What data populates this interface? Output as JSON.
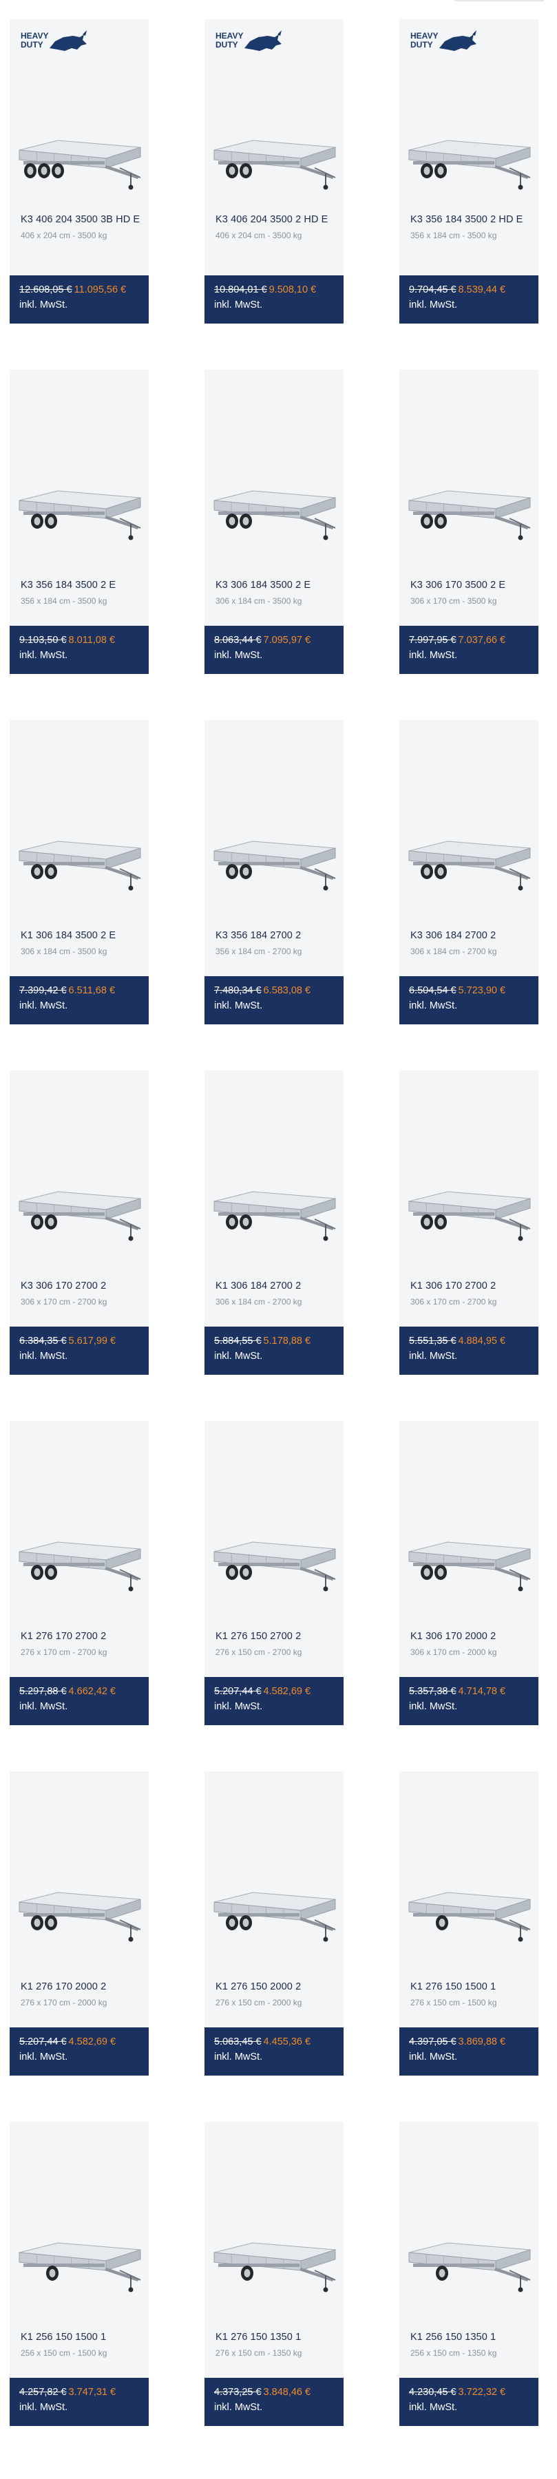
{
  "badge_text_line1": "HEAVY",
  "badge_text_line2": "DUTY",
  "tax_note": "inkl. MwSt.",
  "colors": {
    "card_bg": "#f3f5f7",
    "price_bg": "#1b3260",
    "sale_price": "#f08a28",
    "badge": "#1b3a6b"
  },
  "products": [
    {
      "name": "K3 406 204 3500 3B HD E",
      "spec": "406 x 204 cm - 3500 kg",
      "old_price": "12.608,05 €",
      "price": "11.095,56 €",
      "heavy_duty": true,
      "axles": 3
    },
    {
      "name": "K3 406 204 3500 2 HD E",
      "spec": "406 x 204 cm - 3500 kg",
      "old_price": "10.804,01 €",
      "price": "9.508,10 €",
      "heavy_duty": true,
      "axles": 2
    },
    {
      "name": "K3 356 184 3500 2 HD E",
      "spec": "356 x 184 cm - 3500 kg",
      "old_price": "9.704,45 €",
      "price": "8.539,44 €",
      "heavy_duty": true,
      "axles": 2
    },
    {
      "name": "K3 356 184 3500 2 E",
      "spec": "356 x 184 cm - 3500 kg",
      "old_price": "9.103,50 €",
      "price": "8.011,08 €",
      "heavy_duty": false,
      "axles": 2
    },
    {
      "name": "K3 306 184 3500 2 E",
      "spec": "306 x 184 cm - 3500 kg",
      "old_price": "8.063,44 €",
      "price": "7.095,97 €",
      "heavy_duty": false,
      "axles": 2
    },
    {
      "name": "K3 306 170 3500 2 E",
      "spec": "306 x 170 cm - 3500 kg",
      "old_price": "7.997,95 €",
      "price": "7.037,66 €",
      "heavy_duty": false,
      "axles": 2
    },
    {
      "name": "K1 306 184 3500 2 E",
      "spec": "306 x 184 cm - 3500 kg",
      "old_price": "7.399,42 €",
      "price": "6.511,68 €",
      "heavy_duty": false,
      "axles": 2
    },
    {
      "name": "K3 356 184 2700 2",
      "spec": "356 x 184 cm - 2700 kg",
      "old_price": "7.480,34 €",
      "price": "6.583,08 €",
      "heavy_duty": false,
      "axles": 2
    },
    {
      "name": "K3 306 184 2700 2",
      "spec": "306 x 184 cm - 2700 kg",
      "old_price": "6.504,54 €",
      "price": "5.723,90 €",
      "heavy_duty": false,
      "axles": 2
    },
    {
      "name": "K3 306 170 2700 2",
      "spec": "306 x 170 cm - 2700 kg",
      "old_price": "6.384,35 €",
      "price": "5.617,99 €",
      "heavy_duty": false,
      "axles": 2
    },
    {
      "name": "K1 306 184 2700 2",
      "spec": "306 x 184 cm - 2700 kg",
      "old_price": "5.884,55 €",
      "price": "5.178,88 €",
      "heavy_duty": false,
      "axles": 2
    },
    {
      "name": "K1 306 170 2700 2",
      "spec": "306 x 170 cm - 2700 kg",
      "old_price": "5.551,35 €",
      "price": "4.884,95 €",
      "heavy_duty": false,
      "axles": 2
    },
    {
      "name": "K1 276 170 2700 2",
      "spec": "276 x 170 cm - 2700 kg",
      "old_price": "5.297,88 €",
      "price": "4.662,42 €",
      "heavy_duty": false,
      "axles": 2
    },
    {
      "name": "K1 276 150 2700 2",
      "spec": "276 x 150 cm - 2700 kg",
      "old_price": "5.207,44 €",
      "price": "4.582,69 €",
      "heavy_duty": false,
      "axles": 2
    },
    {
      "name": "K1 306 170 2000 2",
      "spec": "306 x 170 cm - 2000 kg",
      "old_price": "5.357,38 €",
      "price": "4.714,78 €",
      "heavy_duty": false,
      "axles": 2
    },
    {
      "name": "K1 276 170 2000 2",
      "spec": "276 x 170 cm - 2000 kg",
      "old_price": "5.207,44 €",
      "price": "4.582,69 €",
      "heavy_duty": false,
      "axles": 2
    },
    {
      "name": "K1 276 150 2000 2",
      "spec": "276 x 150 cm - 2000 kg",
      "old_price": "5.063,45 €",
      "price": "4.455,36 €",
      "heavy_duty": false,
      "axles": 2
    },
    {
      "name": "K1 276 150 1500 1",
      "spec": "276 x 150 cm - 1500 kg",
      "old_price": "4.397,05 €",
      "price": "3.869,88 €",
      "heavy_duty": false,
      "axles": 1
    },
    {
      "name": "K1 256 150 1500 1",
      "spec": "256 x 150 cm - 1500 kg",
      "old_price": "4.257,82 €",
      "price": "3.747,31 €",
      "heavy_duty": false,
      "axles": 1
    },
    {
      "name": "K1 276 150 1350 1",
      "spec": "276 x 150 cm - 1350 kg",
      "old_price": "4.373,25 €",
      "price": "3.848,46 €",
      "heavy_duty": false,
      "axles": 1
    },
    {
      "name": "K1 256 150 1350 1",
      "spec": "256 x 150 cm - 1350 kg",
      "old_price": "4.230,45 €",
      "price": "3.722,32 €",
      "heavy_duty": false,
      "axles": 1
    }
  ]
}
